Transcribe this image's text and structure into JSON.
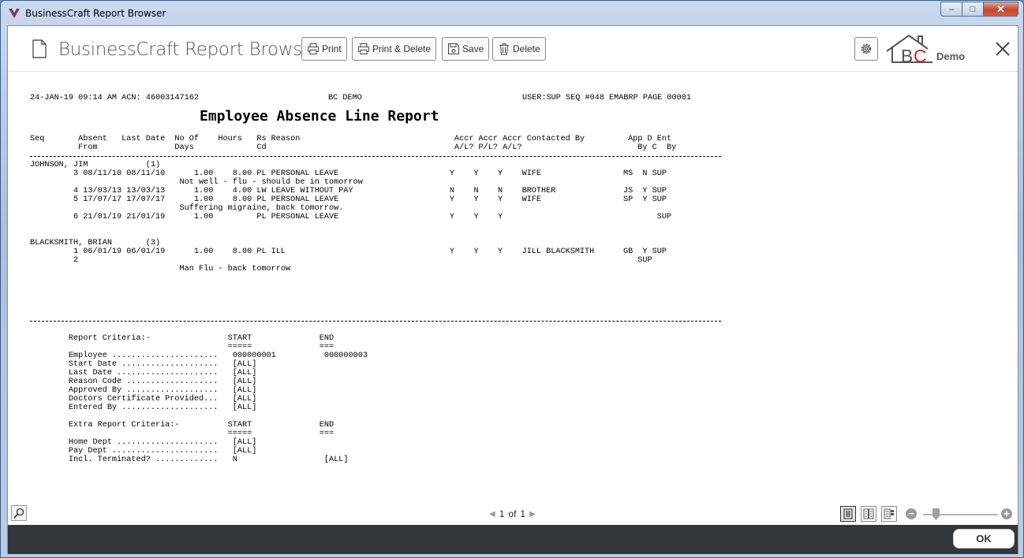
{
  "window": {
    "title": "BusinessCraft Report Browser",
    "minimize": "‒",
    "maximize": "□",
    "close": "✕"
  },
  "header": {
    "title": "BusinessCraft Report Browser",
    "buttons": {
      "print": "Print",
      "print_delete": "Print & Delete",
      "save": "Save",
      "delete": "Delete"
    },
    "logo_text": "BC",
    "logo_demo": "Demo"
  },
  "report": {
    "top_left": "24-JAN-19 09:14 AM ACN: 46003147162",
    "top_center": "BC DEMO",
    "top_right": "USER:SUP SEQ #048 EMABRP PAGE 00001",
    "title": "Employee Absence Line Report",
    "col_header_1": "Seq       Absent   Last Date  No Of    Hours   Rs Reason                                Accr Accr Accr Contacted By         App D Ent",
    "col_header_2": "          From                Days             Cd                                       A/L? P/L? A/L?                        By C  By",
    "employees": [
      {
        "name": "JOHNSON, JIM            (1)",
        "lines": [
          "         3 08/11/10 08/11/10      1.00    8.00 PL PERSONAL LEAVE                       Y    Y    Y    WIFE                 MS  N SUP",
          "                               Not well - flu - should be in tomorrow",
          "         4 13/03/13 13/03/13      1.00    4.00 LW LEAVE WITHOUT PAY                    N    N    N    BROTHER              JS  Y SUP",
          "         5 17/07/17 17/07/17      1.00    8.00 PL PERSONAL LEAVE                       Y    Y    Y    WIFE                 SP  Y SUP",
          "                               Suffering migraine, back tomorrow.",
          "         6 21/01/19 21/01/19      1.00         PL PERSONAL LEAVE                       Y    Y    Y                                SUP"
        ]
      },
      {
        "name": "BLACKSMITH, BRIAN       (3)",
        "lines": [
          "         1 06/01/19 06/01/19      1.00    8.00 PL ILL                                  Y    Y    Y    JILL BLACKSMITH      GB  Y SUP",
          "         2                                                                                                                    SUP",
          "                               Man Flu - back tomorrow"
        ]
      }
    ],
    "criteria": [
      "        Report Criteria:-                START              END",
      "                                         =====              ===",
      "        Employee ......................   000000001          000000003",
      "        Start Date ....................   [ALL]",
      "        Last Date .....................   [ALL]",
      "        Reason Code ...................   [ALL]",
      "        Approved By ...................   [ALL]",
      "        Doctors Certificate Provided...   [ALL]",
      "        Entered By ....................   [ALL]",
      "",
      "        Extra Report Criteria:-          START              END",
      "                                         =====              ===",
      "        Home Dept .....................   [ALL]",
      "        Pay Dept ......................   [ALL]",
      "        Incl. Terminated? .............   N                  [ALL]"
    ]
  },
  "pager": {
    "prev": "◀",
    "current": "1",
    "of": "of",
    "total": "1",
    "next": "▶"
  },
  "zoom": {
    "minus": "−",
    "plus": "+"
  },
  "footer": {
    "ok": "OK"
  }
}
